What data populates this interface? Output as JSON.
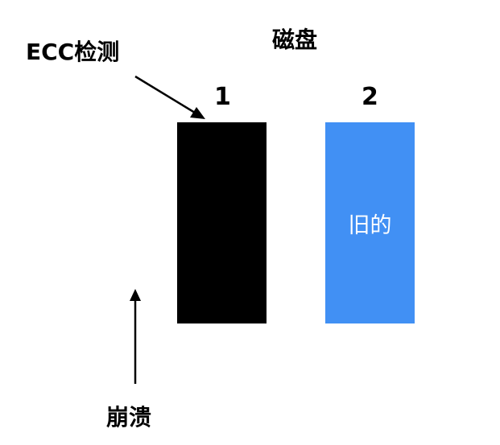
{
  "title": "磁盘",
  "annotations": {
    "ecc_check": "ECC检测",
    "crash": "崩溃"
  },
  "disks": [
    {
      "number": "1",
      "label": "",
      "color": "#000000"
    },
    {
      "number": "2",
      "label": "旧的",
      "color": "#4190f4"
    }
  ]
}
